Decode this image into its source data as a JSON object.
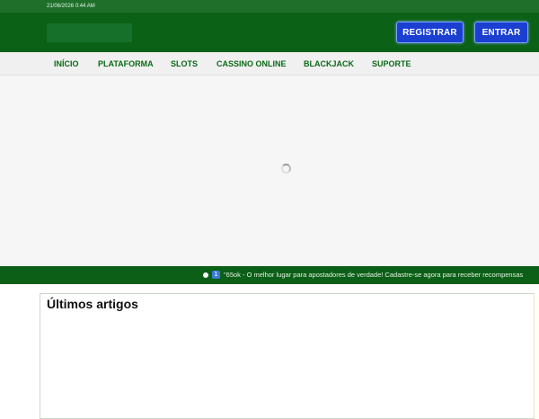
{
  "topbar": {
    "datetime": "21/06/2026 0:44 AM"
  },
  "header": {
    "logo_icon": "logo",
    "register_label": "REGISTRAR",
    "login_label": "ENTRAR"
  },
  "nav": {
    "items": [
      {
        "label": "INÍCIO"
      },
      {
        "label": "PLATAFORMA"
      },
      {
        "label": "SLOTS"
      },
      {
        "label": "CASSINO ONLINE"
      },
      {
        "label": "BLACKJACK"
      },
      {
        "label": "SUPORTE"
      }
    ]
  },
  "hero": {
    "loading_icon": "spinner-icon"
  },
  "ticker": {
    "bullet_icon": "dot-icon",
    "emoji_icon": "keycap-number-icon",
    "emoji_glyph": "1",
    "text": "\"65ok - O melhor lugar para apostadores de verdade! Cadastre-se agora para receber recompensas"
  },
  "articles": {
    "heading": "Últimos artigos"
  },
  "colors": {
    "header_green": "#0b6216",
    "nav_text_green": "#0b6a17",
    "button_blue": "#1a3fd1",
    "nav_bg": "#f0f0f0"
  }
}
